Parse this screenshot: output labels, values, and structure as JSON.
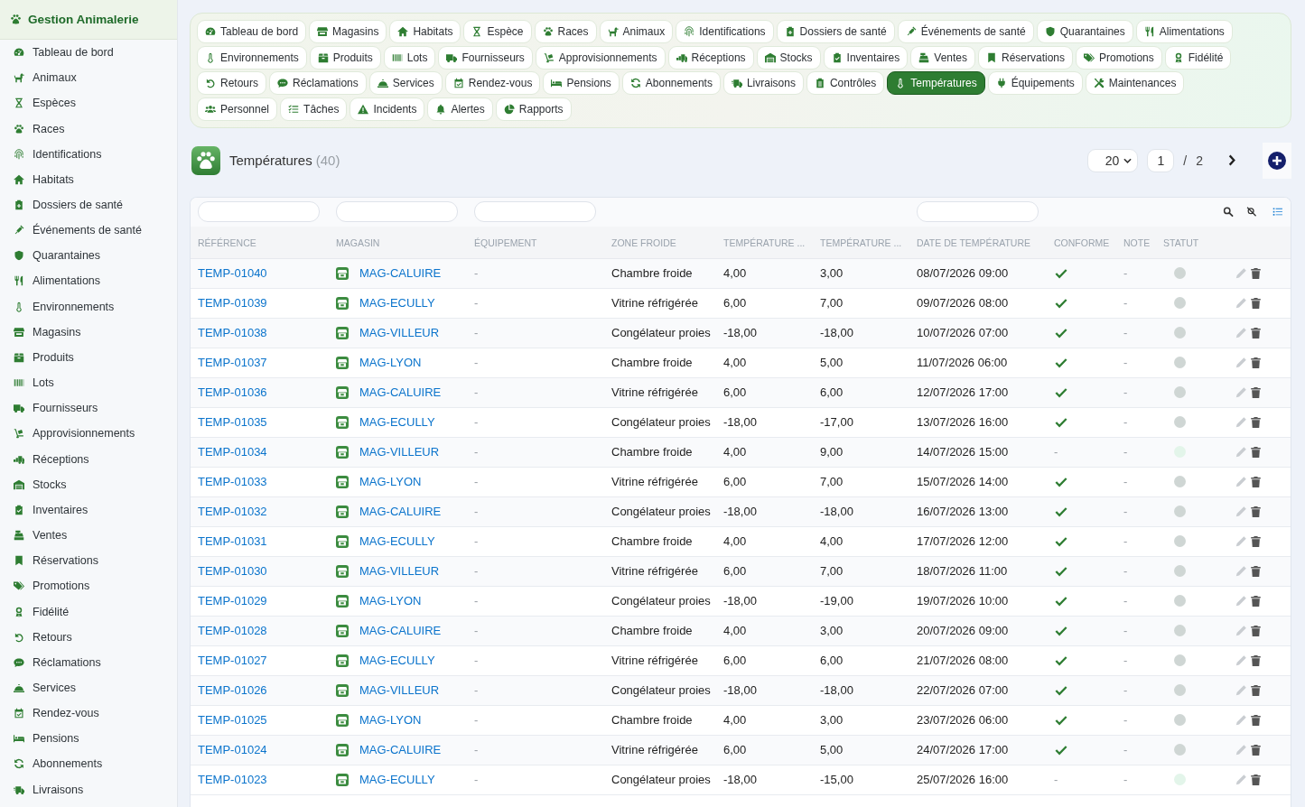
{
  "sidebar": {
    "title": "Gestion Animalerie",
    "items": [
      {
        "label": "Tableau de bord"
      },
      {
        "label": "Animaux"
      },
      {
        "label": "Espèces"
      },
      {
        "label": "Races"
      },
      {
        "label": "Identifications"
      },
      {
        "label": "Habitats"
      },
      {
        "label": "Dossiers de santé"
      },
      {
        "label": "Événements de santé"
      },
      {
        "label": "Quarantaines"
      },
      {
        "label": "Alimentations"
      },
      {
        "label": "Environnements"
      },
      {
        "label": "Magasins"
      },
      {
        "label": "Produits"
      },
      {
        "label": "Lots"
      },
      {
        "label": "Fournisseurs"
      },
      {
        "label": "Approvisionnements"
      },
      {
        "label": "Réceptions"
      },
      {
        "label": "Stocks"
      },
      {
        "label": "Inventaires"
      },
      {
        "label": "Ventes"
      },
      {
        "label": "Réservations"
      },
      {
        "label": "Promotions"
      },
      {
        "label": "Fidélité"
      },
      {
        "label": "Retours"
      },
      {
        "label": "Réclamations"
      },
      {
        "label": "Services"
      },
      {
        "label": "Rendez-vous"
      },
      {
        "label": "Pensions"
      },
      {
        "label": "Abonnements"
      },
      {
        "label": "Livraisons"
      }
    ]
  },
  "tab_rows": [
    {
      "tabs": [
        {
          "label": "Tableau de bord",
          "selected": false
        },
        {
          "label": "Magasins",
          "selected": false
        },
        {
          "label": "Habitats",
          "selected": false
        },
        {
          "label": "Espèce",
          "selected": false
        },
        {
          "label": "Races",
          "selected": false
        },
        {
          "label": "Animaux",
          "selected": false
        },
        {
          "label": "Identifications",
          "selected": false
        },
        {
          "label": "Dossiers de santé",
          "selected": false
        },
        {
          "label": "Événements de santé",
          "selected": false
        },
        {
          "label": "Quarantaines",
          "selected": false
        },
        {
          "label": "Alimentations",
          "selected": false
        }
      ]
    },
    {
      "tabs": [
        {
          "label": "Environnements",
          "selected": false
        },
        {
          "label": "Produits",
          "selected": false
        },
        {
          "label": "Lots",
          "selected": false
        },
        {
          "label": "Fournisseurs",
          "selected": false
        },
        {
          "label": "Approvisionnements",
          "selected": false
        },
        {
          "label": "Réceptions",
          "selected": false
        },
        {
          "label": "Stocks",
          "selected": false
        },
        {
          "label": "Inventaires",
          "selected": false
        },
        {
          "label": "Ventes",
          "selected": false
        },
        {
          "label": "Réservations",
          "selected": false
        },
        {
          "label": "Promotions",
          "selected": false
        },
        {
          "label": "Fidélité",
          "selected": false
        }
      ]
    },
    {
      "tabs": [
        {
          "label": "Retours",
          "selected": false
        },
        {
          "label": "Réclamations",
          "selected": false
        },
        {
          "label": "Services",
          "selected": false
        },
        {
          "label": "Rendez-vous",
          "selected": false
        },
        {
          "label": "Pensions",
          "selected": false
        },
        {
          "label": "Abonnements",
          "selected": false
        },
        {
          "label": "Livraisons",
          "selected": false
        },
        {
          "label": "Contrôles",
          "selected": false
        },
        {
          "label": "Températures",
          "selected": true
        },
        {
          "label": "Équipements",
          "selected": false
        },
        {
          "label": "Maintenances",
          "selected": false
        }
      ]
    },
    {
      "tabs": [
        {
          "label": "Personnel",
          "selected": false
        },
        {
          "label": "Tâches",
          "selected": false
        },
        {
          "label": "Incidents",
          "selected": false
        },
        {
          "label": "Alertes",
          "selected": false
        },
        {
          "label": "Rapports",
          "selected": false
        }
      ]
    }
  ],
  "page_header": {
    "title": "Températures",
    "count": "(40)",
    "page_size": "20",
    "page": "1",
    "page_separator": "/",
    "page_total": "2"
  },
  "table": {
    "columns": [
      {
        "label": "RÉFÉRENCE",
        "filter": true
      },
      {
        "label": "MAGASIN",
        "filter": true
      },
      {
        "label": "ÉQUIPEMENT",
        "filter": true
      },
      {
        "label": "ZONE FROIDE",
        "filter": false
      },
      {
        "label": "TEMPÉRATURE ...",
        "filter": false
      },
      {
        "label": "TEMPÉRATURE ...",
        "filter": false
      },
      {
        "label": "DATE DE TEMPÉRATURE",
        "filter": true
      },
      {
        "label": "CONFORME",
        "filter": false
      },
      {
        "label": "NOTE",
        "filter": false
      },
      {
        "label": "STATUT",
        "filter": false
      }
    ],
    "rows": [
      {
        "reference": "TEMP-01040",
        "magasin": "MAG-CALUIRE",
        "equipement": "-",
        "zone": "Chambre froide",
        "temperature_1": "4,00",
        "temperature_2": "3,00",
        "date": "08/07/2026 09:00",
        "conforme": true,
        "note": "-",
        "status": {
          "color": "#cfd6d4"
        }
      },
      {
        "reference": "TEMP-01039",
        "magasin": "MAG-ECULLY",
        "equipement": "-",
        "zone": "Vitrine réfrigérée",
        "temperature_1": "6,00",
        "temperature_2": "7,00",
        "date": "09/07/2026 08:00",
        "conforme": true,
        "note": "-",
        "status": {
          "color": "#cfd6d4"
        }
      },
      {
        "reference": "TEMP-01038",
        "magasin": "MAG-VILLEUR",
        "equipement": "-",
        "zone": "Congélateur proies",
        "temperature_1": "-18,00",
        "temperature_2": "-18,00",
        "date": "10/07/2026 07:00",
        "conforme": true,
        "note": "-",
        "status": {
          "color": "#cfd6d4"
        }
      },
      {
        "reference": "TEMP-01037",
        "magasin": "MAG-LYON",
        "equipement": "-",
        "zone": "Chambre froide",
        "temperature_1": "4,00",
        "temperature_2": "5,00",
        "date": "11/07/2026 06:00",
        "conforme": true,
        "note": "-",
        "status": {
          "color": "#cfd6d4"
        }
      },
      {
        "reference": "TEMP-01036",
        "magasin": "MAG-CALUIRE",
        "equipement": "-",
        "zone": "Vitrine réfrigérée",
        "temperature_1": "6,00",
        "temperature_2": "6,00",
        "date": "12/07/2026 17:00",
        "conforme": true,
        "note": "-",
        "status": {
          "color": "#cfd6d4"
        }
      },
      {
        "reference": "TEMP-01035",
        "magasin": "MAG-ECULLY",
        "equipement": "-",
        "zone": "Congélateur proies",
        "temperature_1": "-18,00",
        "temperature_2": "-17,00",
        "date": "13/07/2026 16:00",
        "conforme": true,
        "note": "-",
        "status": {
          "color": "#cfd6d4"
        }
      },
      {
        "reference": "TEMP-01034",
        "magasin": "MAG-VILLEUR",
        "equipement": "-",
        "zone": "Chambre froide",
        "temperature_1": "4,00",
        "temperature_2": "9,00",
        "date": "14/07/2026 15:00",
        "conforme": false,
        "conforme_text": "-",
        "note": "-",
        "status": {
          "color": "#e3f5ea"
        }
      },
      {
        "reference": "TEMP-01033",
        "magasin": "MAG-LYON",
        "equipement": "-",
        "zone": "Vitrine réfrigérée",
        "temperature_1": "6,00",
        "temperature_2": "7,00",
        "date": "15/07/2026 14:00",
        "conforme": true,
        "note": "-",
        "status": {
          "color": "#cfd6d4"
        }
      },
      {
        "reference": "TEMP-01032",
        "magasin": "MAG-CALUIRE",
        "equipement": "-",
        "zone": "Congélateur proies",
        "temperature_1": "-18,00",
        "temperature_2": "-18,00",
        "date": "16/07/2026 13:00",
        "conforme": true,
        "note": "-",
        "status": {
          "color": "#cfd6d4"
        }
      },
      {
        "reference": "TEMP-01031",
        "magasin": "MAG-ECULLY",
        "equipement": "-",
        "zone": "Chambre froide",
        "temperature_1": "4,00",
        "temperature_2": "4,00",
        "date": "17/07/2026 12:00",
        "conforme": true,
        "note": "-",
        "status": {
          "color": "#cfd6d4"
        }
      },
      {
        "reference": "TEMP-01030",
        "magasin": "MAG-VILLEUR",
        "equipement": "-",
        "zone": "Vitrine réfrigérée",
        "temperature_1": "6,00",
        "temperature_2": "7,00",
        "date": "18/07/2026 11:00",
        "conforme": true,
        "note": "-",
        "status": {
          "color": "#cfd6d4"
        }
      },
      {
        "reference": "TEMP-01029",
        "magasin": "MAG-LYON",
        "equipement": "-",
        "zone": "Congélateur proies",
        "temperature_1": "-18,00",
        "temperature_2": "-19,00",
        "date": "19/07/2026 10:00",
        "conforme": true,
        "note": "-",
        "status": {
          "color": "#cfd6d4"
        }
      },
      {
        "reference": "TEMP-01028",
        "magasin": "MAG-CALUIRE",
        "equipement": "-",
        "zone": "Chambre froide",
        "temperature_1": "4,00",
        "temperature_2": "3,00",
        "date": "20/07/2026 09:00",
        "conforme": true,
        "note": "-",
        "status": {
          "color": "#cfd6d4"
        }
      },
      {
        "reference": "TEMP-01027",
        "magasin": "MAG-ECULLY",
        "equipement": "-",
        "zone": "Vitrine réfrigérée",
        "temperature_1": "6,00",
        "temperature_2": "6,00",
        "date": "21/07/2026 08:00",
        "conforme": true,
        "note": "-",
        "status": {
          "color": "#cfd6d4"
        }
      },
      {
        "reference": "TEMP-01026",
        "magasin": "MAG-VILLEUR",
        "equipement": "-",
        "zone": "Congélateur proies",
        "temperature_1": "-18,00",
        "temperature_2": "-18,00",
        "date": "22/07/2026 07:00",
        "conforme": true,
        "note": "-",
        "status": {
          "color": "#cfd6d4"
        }
      },
      {
        "reference": "TEMP-01025",
        "magasin": "MAG-LYON",
        "equipement": "-",
        "zone": "Chambre froide",
        "temperature_1": "4,00",
        "temperature_2": "3,00",
        "date": "23/07/2026 06:00",
        "conforme": true,
        "note": "-",
        "status": {
          "color": "#cfd6d4"
        }
      },
      {
        "reference": "TEMP-01024",
        "magasin": "MAG-CALUIRE",
        "equipement": "-",
        "zone": "Vitrine réfrigérée",
        "temperature_1": "6,00",
        "temperature_2": "5,00",
        "date": "24/07/2026 17:00",
        "conforme": true,
        "note": "-",
        "status": {
          "color": "#cfd6d4"
        }
      },
      {
        "reference": "TEMP-01023",
        "magasin": "MAG-ECULLY",
        "equipement": "-",
        "zone": "Congélateur proies",
        "temperature_1": "-18,00",
        "temperature_2": "-15,00",
        "date": "25/07/2026 16:00",
        "conforme": false,
        "conforme_text": "-",
        "note": "-",
        "status": {
          "color": "#e3f5ea"
        }
      }
    ]
  }
}
